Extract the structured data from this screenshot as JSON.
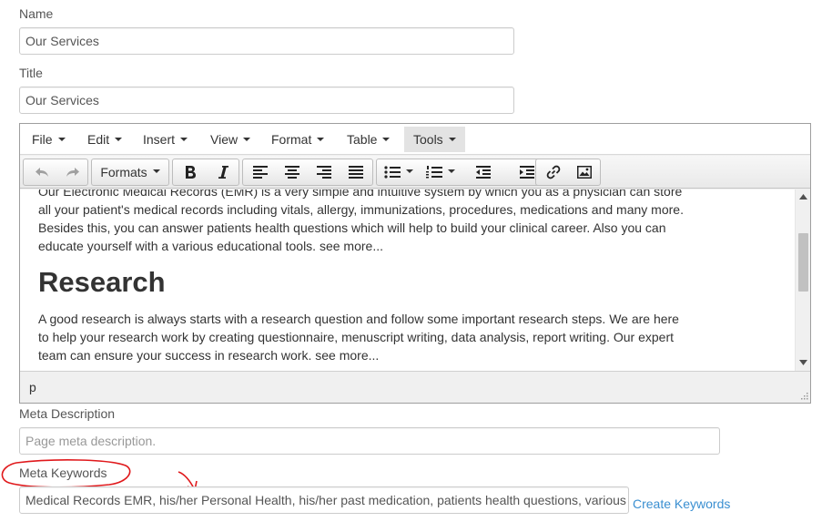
{
  "fields": {
    "name": {
      "label": "Name",
      "value": "Our Services"
    },
    "title": {
      "label": "Title",
      "value": "Our Services"
    },
    "meta_description": {
      "label": "Meta Description",
      "placeholder": "Page meta description."
    },
    "meta_keywords": {
      "label": "Meta Keywords",
      "value": "Medical Records EMR, his/her Personal Health, his/her past medication, patients health questions, various"
    },
    "create_keywords": "Create Keywords"
  },
  "editor": {
    "menu": [
      "File",
      "Edit",
      "Insert",
      "View",
      "Format",
      "Table",
      "Tools"
    ],
    "active_menu": "Tools",
    "toolbar": {
      "formats_label": "Formats",
      "icons": [
        "undo-icon",
        "redo-icon",
        "bold-icon",
        "italic-icon",
        "align-left-icon",
        "align-center-icon",
        "align-right-icon",
        "align-justify-icon",
        "bullet-list-icon",
        "numbered-list-icon",
        "outdent-icon",
        "indent-icon",
        "link-icon",
        "image-icon"
      ]
    },
    "content": {
      "para1_line1": "Our Electronic Medical Records (EMR) is a very simple and intuitive system by which you as a physician can store",
      "para1_line2": "all your patient's medical records including vitals, allergy, immunizations, procedures, medications and many more.",
      "para1_line3": "Besides this, you can answer patients health questions which will help to build your clinical career. Also you can",
      "para1_line4": "educate yourself with a various educational tools. see more...",
      "heading": "Research",
      "para2_line1": "A good research is always starts with a research question and follow some important research steps. We are here",
      "para2_line2": "to help your research work by creating questionnaire, menuscript writing, data analysis, report writing. Our expert",
      "para2_line3": "team can ensure your success in research work. see more..."
    },
    "statusbar_path": "p"
  },
  "colors": {
    "annotation": "#e0191c",
    "link": "#3a8fd1",
    "border": "#cccccc"
  }
}
